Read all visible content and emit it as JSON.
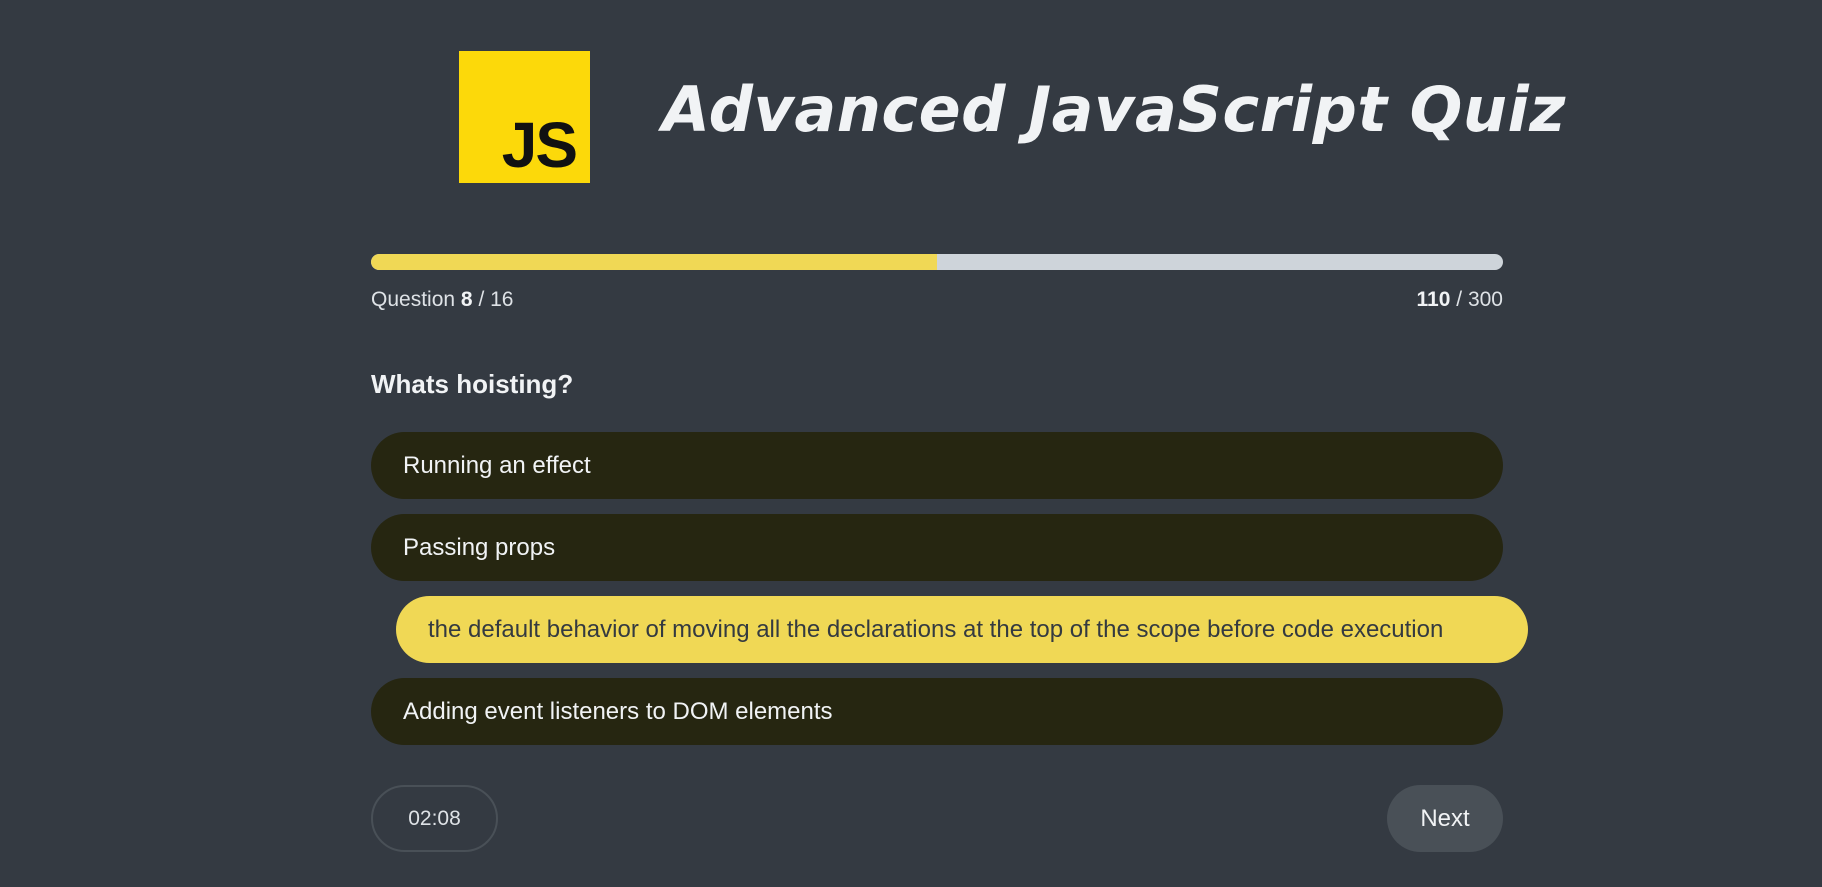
{
  "header": {
    "logo_text": "JS",
    "title": "Advanced JavaScript Quiz"
  },
  "progress": {
    "fraction": 0.5,
    "question_label": "Question",
    "current_question": "8",
    "question_separator": "/",
    "total_questions": "16",
    "points": "110",
    "points_separator": "/",
    "max_points": "300"
  },
  "question": {
    "text": "Whats hoisting?",
    "options": [
      {
        "label": "Running an effect",
        "selected": false
      },
      {
        "label": "Passing props",
        "selected": false
      },
      {
        "label": "the default behavior of moving all the declarations at the top of the scope before code execution",
        "selected": true
      },
      {
        "label": "Adding event listeners to DOM elements",
        "selected": false
      }
    ]
  },
  "footer": {
    "timer": "02:08",
    "next_label": "Next"
  },
  "colors": {
    "background": "#343a42",
    "accent": "#f0d855",
    "logo": "#fcd90a",
    "option_bg": "#262611",
    "button_bg": "#495057"
  }
}
